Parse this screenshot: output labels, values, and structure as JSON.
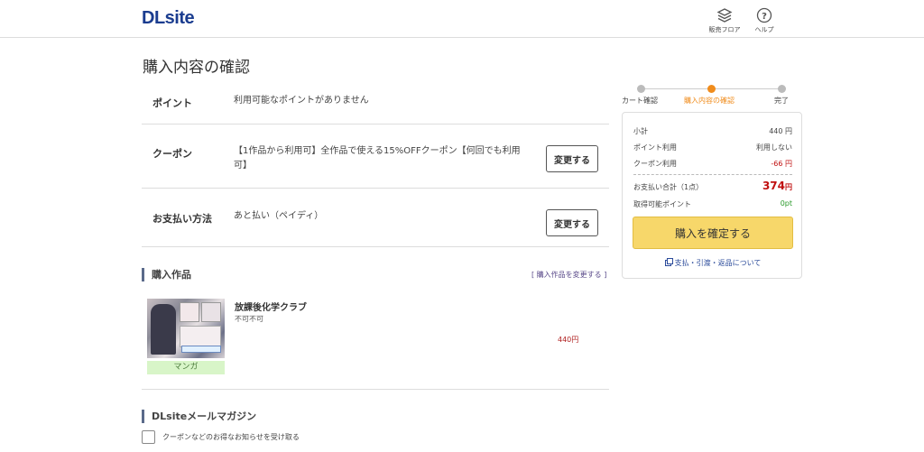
{
  "header": {
    "logo": "DLsite",
    "sales_floor_label": "販売フロア",
    "help_label": "ヘルプ"
  },
  "page_title": "購入内容の確認",
  "rows": {
    "points": {
      "label": "ポイント",
      "value": "利用可能なポイントがありません"
    },
    "coupon": {
      "label": "クーポン",
      "value": "【1作品から利用可】全作品で使える15%OFFクーポン【何回でも利用可】",
      "button": "変更する"
    },
    "payment": {
      "label": "お支払い方法",
      "value": "あと払い（ペイディ）",
      "button": "変更する"
    }
  },
  "items_section": {
    "title": "購入作品",
    "change_link": "[ 購入作品を変更する ]",
    "item": {
      "title": "放課後化学クラブ",
      "circle": "不可不可",
      "tag": "マンガ",
      "price": "440円"
    }
  },
  "newsletter": {
    "title": "DLsiteメールマガジン",
    "checkbox_label": "クーポンなどのお得なお知らせを受け取る"
  },
  "steps": [
    {
      "label": "カート確認",
      "active": false
    },
    {
      "label": "購入内容の確認",
      "active": true
    },
    {
      "label": "完了",
      "active": false
    }
  ],
  "summary": {
    "subtotal_label": "小計",
    "subtotal_value": "440 円",
    "points_label": "ポイント利用",
    "points_value": "利用しない",
    "coupon_label": "クーポン利用",
    "coupon_value": "-66 円",
    "total_label": "お支払い合計（1点）",
    "total_value": "374",
    "total_unit": "円",
    "earn_label": "取得可能ポイント",
    "earn_value": "0pt",
    "buy_button": "購入を確定する",
    "terms_link": "支払・引渡・返品について"
  },
  "colors": {
    "accent": "#f08c1c",
    "price_red": "#c01010",
    "points_green": "#2a9a2a",
    "buy_button": "#f7d76a"
  }
}
